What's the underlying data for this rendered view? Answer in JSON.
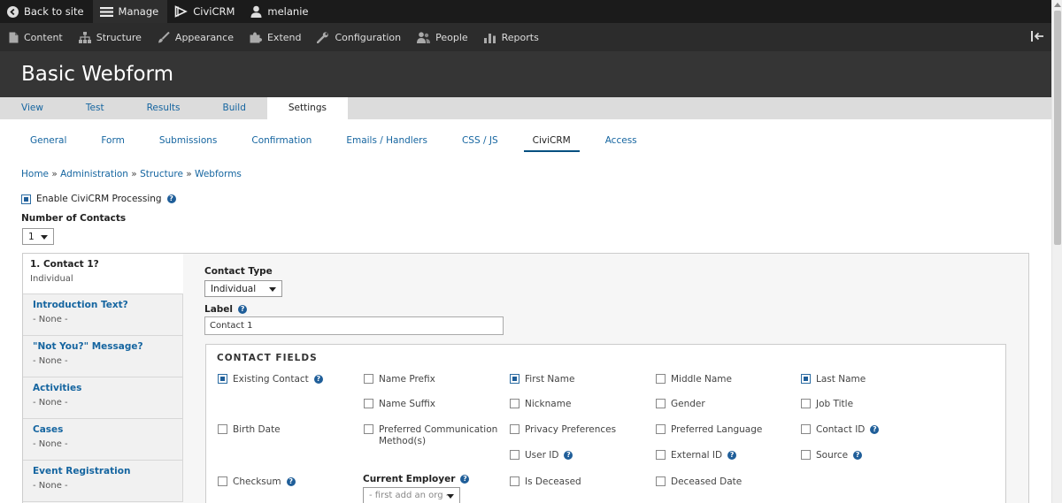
{
  "toolbar": {
    "back_to_site": "Back to site",
    "manage": "Manage",
    "civicrm": "CiviCRM",
    "user": "melanie"
  },
  "tray": {
    "items": [
      "Content",
      "Structure",
      "Appearance",
      "Extend",
      "Configuration",
      "People",
      "Reports"
    ]
  },
  "page_title": "Basic Webform",
  "primary_tabs": [
    "View",
    "Test",
    "Results",
    "Build",
    "Settings"
  ],
  "primary_active": "Settings",
  "secondary_tabs": [
    "General",
    "Form",
    "Submissions",
    "Confirmation",
    "Emails / Handlers",
    "CSS / JS",
    "CiviCRM",
    "Access"
  ],
  "secondary_active": "CiviCRM",
  "breadcrumb": [
    "Home",
    "Administration",
    "Structure",
    "Webforms"
  ],
  "enable_civicrm": {
    "label": "Enable CiviCRM Processing",
    "checked": true
  },
  "number_of_contacts": {
    "label": "Number of Contacts",
    "value": "1"
  },
  "vertical_tabs": [
    {
      "title": "1. Contact 1?",
      "summary": "Individual",
      "active": true
    },
    {
      "title": "Introduction Text?",
      "summary": "- None -"
    },
    {
      "title": "\"Not You?\" Message?",
      "summary": "- None -"
    },
    {
      "title": "Activities",
      "summary": "- None -"
    },
    {
      "title": "Cases",
      "summary": "- None -"
    },
    {
      "title": "Event Registration",
      "summary": "- None -"
    }
  ],
  "contact_type": {
    "label": "Contact Type",
    "value": "Individual"
  },
  "contact_label": {
    "label": "Label",
    "value": "Contact 1"
  },
  "contact_fields": {
    "legend": "CONTACT FIELDS",
    "fields": {
      "existing_contact": {
        "label": "Existing Contact",
        "checked": true
      },
      "name_prefix": {
        "label": "Name Prefix",
        "checked": false
      },
      "first_name": {
        "label": "First Name",
        "checked": true
      },
      "middle_name": {
        "label": "Middle Name",
        "checked": false
      },
      "last_name": {
        "label": "Last Name",
        "checked": true
      },
      "name_suffix": {
        "label": "Name Suffix",
        "checked": false
      },
      "nickname": {
        "label": "Nickname",
        "checked": false
      },
      "gender": {
        "label": "Gender",
        "checked": false
      },
      "job_title": {
        "label": "Job Title",
        "checked": false
      },
      "birth_date": {
        "label": "Birth Date",
        "checked": false
      },
      "preferred_comm_method_1": "Preferred Communication",
      "preferred_comm_method_2": "Method(s)",
      "privacy_preferences": {
        "label": "Privacy Preferences",
        "checked": false
      },
      "preferred_language": {
        "label": "Preferred Language",
        "checked": false
      },
      "contact_id": {
        "label": "Contact ID",
        "checked": false
      },
      "user_id": {
        "label": "User ID",
        "checked": false
      },
      "external_id": {
        "label": "External ID",
        "checked": false
      },
      "source": {
        "label": "Source",
        "checked": false
      },
      "checksum": {
        "label": "Checksum",
        "checked": false
      },
      "is_deceased": {
        "label": "Is Deceased",
        "checked": false
      },
      "deceased_date": {
        "label": "Deceased Date",
        "checked": false
      }
    },
    "current_employer": {
      "label": "Current Employer",
      "value": "- first add an org -"
    }
  }
}
